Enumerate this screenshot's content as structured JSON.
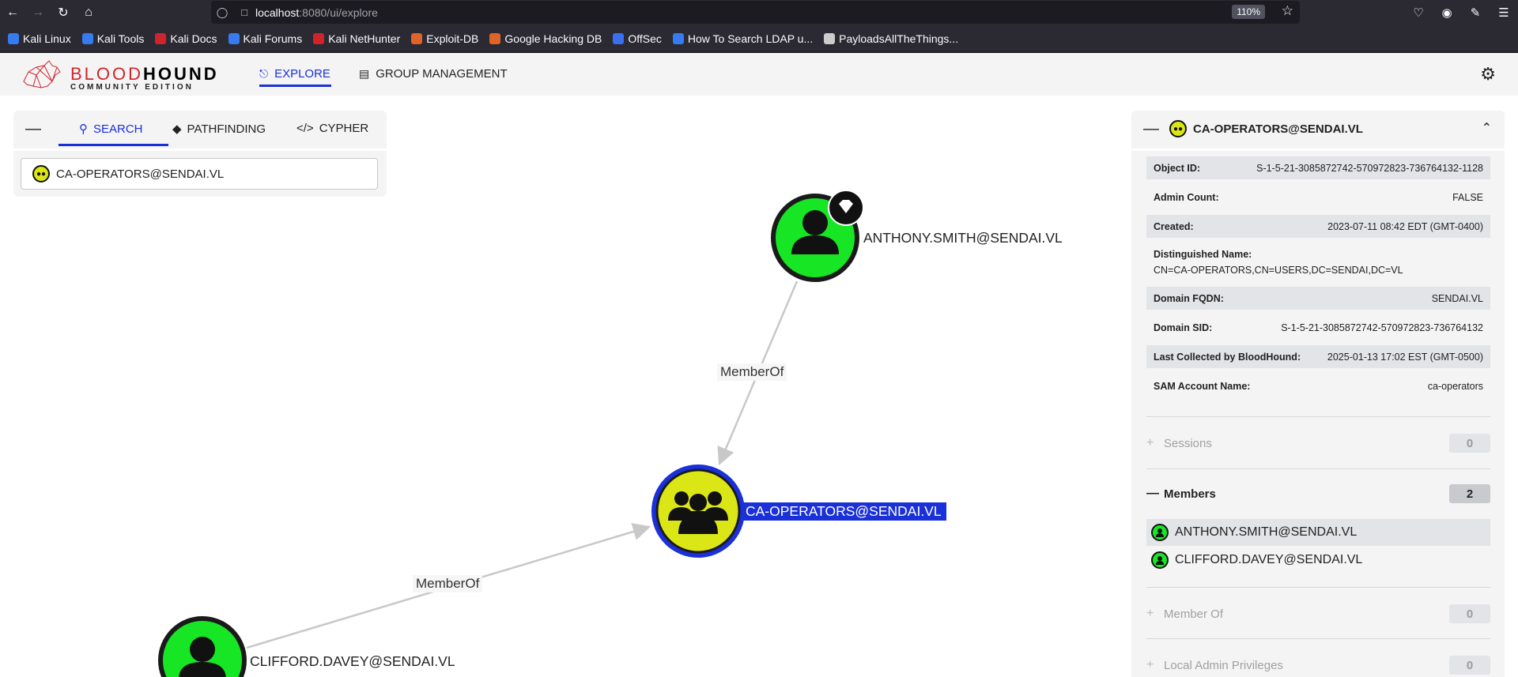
{
  "browser": {
    "url_host": "localhost",
    "url_rest": ":8080/ui/explore",
    "zoom": "110%"
  },
  "bookmarks": [
    {
      "label": "Kali Linux",
      "color": "#367bf0"
    },
    {
      "label": "Kali Tools",
      "color": "#367bf0"
    },
    {
      "label": "Kali Docs",
      "color": "#d0242d"
    },
    {
      "label": "Kali Forums",
      "color": "#367bf0"
    },
    {
      "label": "Kali NetHunter",
      "color": "#d0242d"
    },
    {
      "label": "Exploit-DB",
      "color": "#e0632a"
    },
    {
      "label": "Google Hacking DB",
      "color": "#e0632a"
    },
    {
      "label": "OffSec",
      "color": "#3a6ff0"
    },
    {
      "label": "How To Search LDAP u...",
      "color": "#367bf0"
    },
    {
      "label": "PayloadsAllTheThings...",
      "color": "#cccccc"
    }
  ],
  "header": {
    "logo_blood": "BLOOD",
    "logo_hound": "HOUND",
    "logo_sub": "COMMUNITY EDITION",
    "nav_explore": "EXPLORE",
    "nav_group": "GROUP MANAGEMENT"
  },
  "search": {
    "tab_search": "SEARCH",
    "tab_pathfinding": "PATHFINDING",
    "tab_cypher": "CYPHER",
    "query": "CA-OPERATORS@SENDAI.VL"
  },
  "graph": {
    "nodes": [
      {
        "label": "ANTHONY.SMITH@SENDAI.VL",
        "kind": "user",
        "color": "#17e625"
      },
      {
        "label": "CA-OPERATORS@SENDAI.VL",
        "kind": "group",
        "color": "#dbe617"
      },
      {
        "label": "CLIFFORD.DAVEY@SENDAI.VL",
        "kind": "user",
        "color": "#17e625"
      }
    ],
    "edges": [
      {
        "label": "MemberOf"
      },
      {
        "label": "MemberOf"
      }
    ]
  },
  "entity": {
    "title": "CA-OPERATORS@SENDAI.VL",
    "props": [
      {
        "k": "Object ID:",
        "v": "S-1-5-21-3085872742-570972823-736764132-1128"
      },
      {
        "k": "Admin Count:",
        "v": "FALSE"
      },
      {
        "k": "Created:",
        "v": "2023-07-11 08:42 EDT (GMT-0400)"
      },
      {
        "k": "Distinguished Name:",
        "v": "CN=CA-OPERATORS,CN=USERS,DC=SENDAI,DC=VL"
      },
      {
        "k": "Domain FQDN:",
        "v": "SENDAI.VL"
      },
      {
        "k": "Domain SID:",
        "v": "S-1-5-21-3085872742-570972823-736764132"
      },
      {
        "k": "Last Collected by BloodHound:",
        "v": "2025-01-13 17:02 EST (GMT-0500)"
      },
      {
        "k": "SAM Account Name:",
        "v": "ca-operators"
      }
    ],
    "sections": {
      "sessions": {
        "label": "Sessions",
        "count": "0"
      },
      "members": {
        "label": "Members",
        "count": "2"
      },
      "member_of": {
        "label": "Member Of",
        "count": "0"
      },
      "local_admin": {
        "label": "Local Admin Privileges",
        "count": "0"
      }
    },
    "members": [
      "ANTHONY.SMITH@SENDAI.VL",
      "CLIFFORD.DAVEY@SENDAI.VL"
    ]
  }
}
